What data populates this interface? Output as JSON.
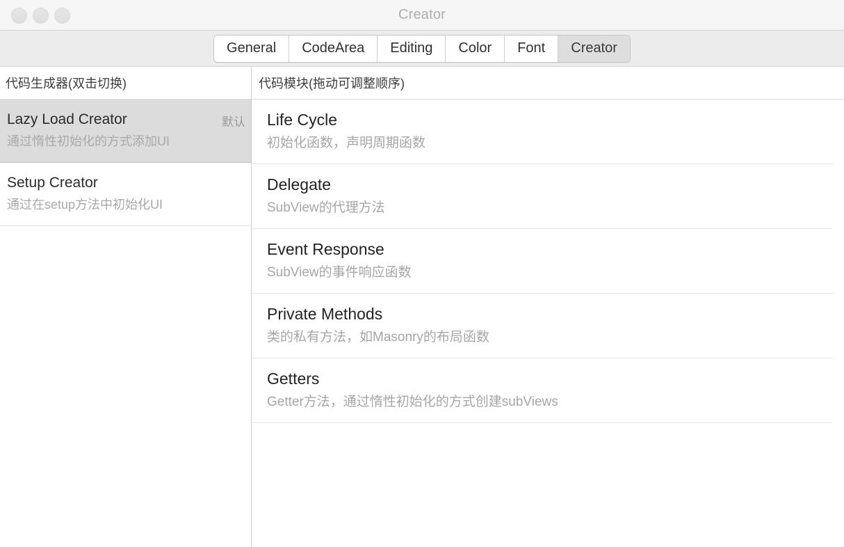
{
  "window": {
    "title": "Creator",
    "traffic_lights": [
      "close-button",
      "minimize-button",
      "zoom-button"
    ]
  },
  "toolbar": {
    "tabs": [
      {
        "label": "General",
        "selected": false
      },
      {
        "label": "CodeArea",
        "selected": false
      },
      {
        "label": "Editing",
        "selected": false
      },
      {
        "label": "Color",
        "selected": false
      },
      {
        "label": "Font",
        "selected": false
      },
      {
        "label": "Creator",
        "selected": true
      }
    ]
  },
  "left_pane": {
    "header": "代码生成器(双击切换)",
    "items": [
      {
        "title": "Lazy Load Creator",
        "subtitle": "通过惰性初始化的方式添加UI",
        "badge": "默认",
        "selected": true
      },
      {
        "title": "Setup Creator",
        "subtitle": "通过在setup方法中初始化UI",
        "badge": "",
        "selected": false
      }
    ]
  },
  "right_pane": {
    "header": "代码模块(拖动可调整顺序)",
    "items": [
      {
        "title": "Life Cycle",
        "subtitle": "初始化函数，声明周期函数"
      },
      {
        "title": "Delegate",
        "subtitle": "SubView的代理方法"
      },
      {
        "title": "Event Response",
        "subtitle": "SubView的事件响应函数"
      },
      {
        "title": "Private Methods",
        "subtitle": "类的私有方法，如Masonry的布局函数"
      },
      {
        "title": "Getters",
        "subtitle": "Getter方法，通过惰性初始化的方式创建subViews"
      }
    ]
  },
  "colors": {
    "titlebar_bg": "#f6f6f6",
    "toolbar_bg": "#ececec",
    "selection_bg": "#dcdcdc",
    "title_text": "#aeaeae",
    "primary_text": "#232323",
    "secondary_text": "#a6a6a6"
  }
}
